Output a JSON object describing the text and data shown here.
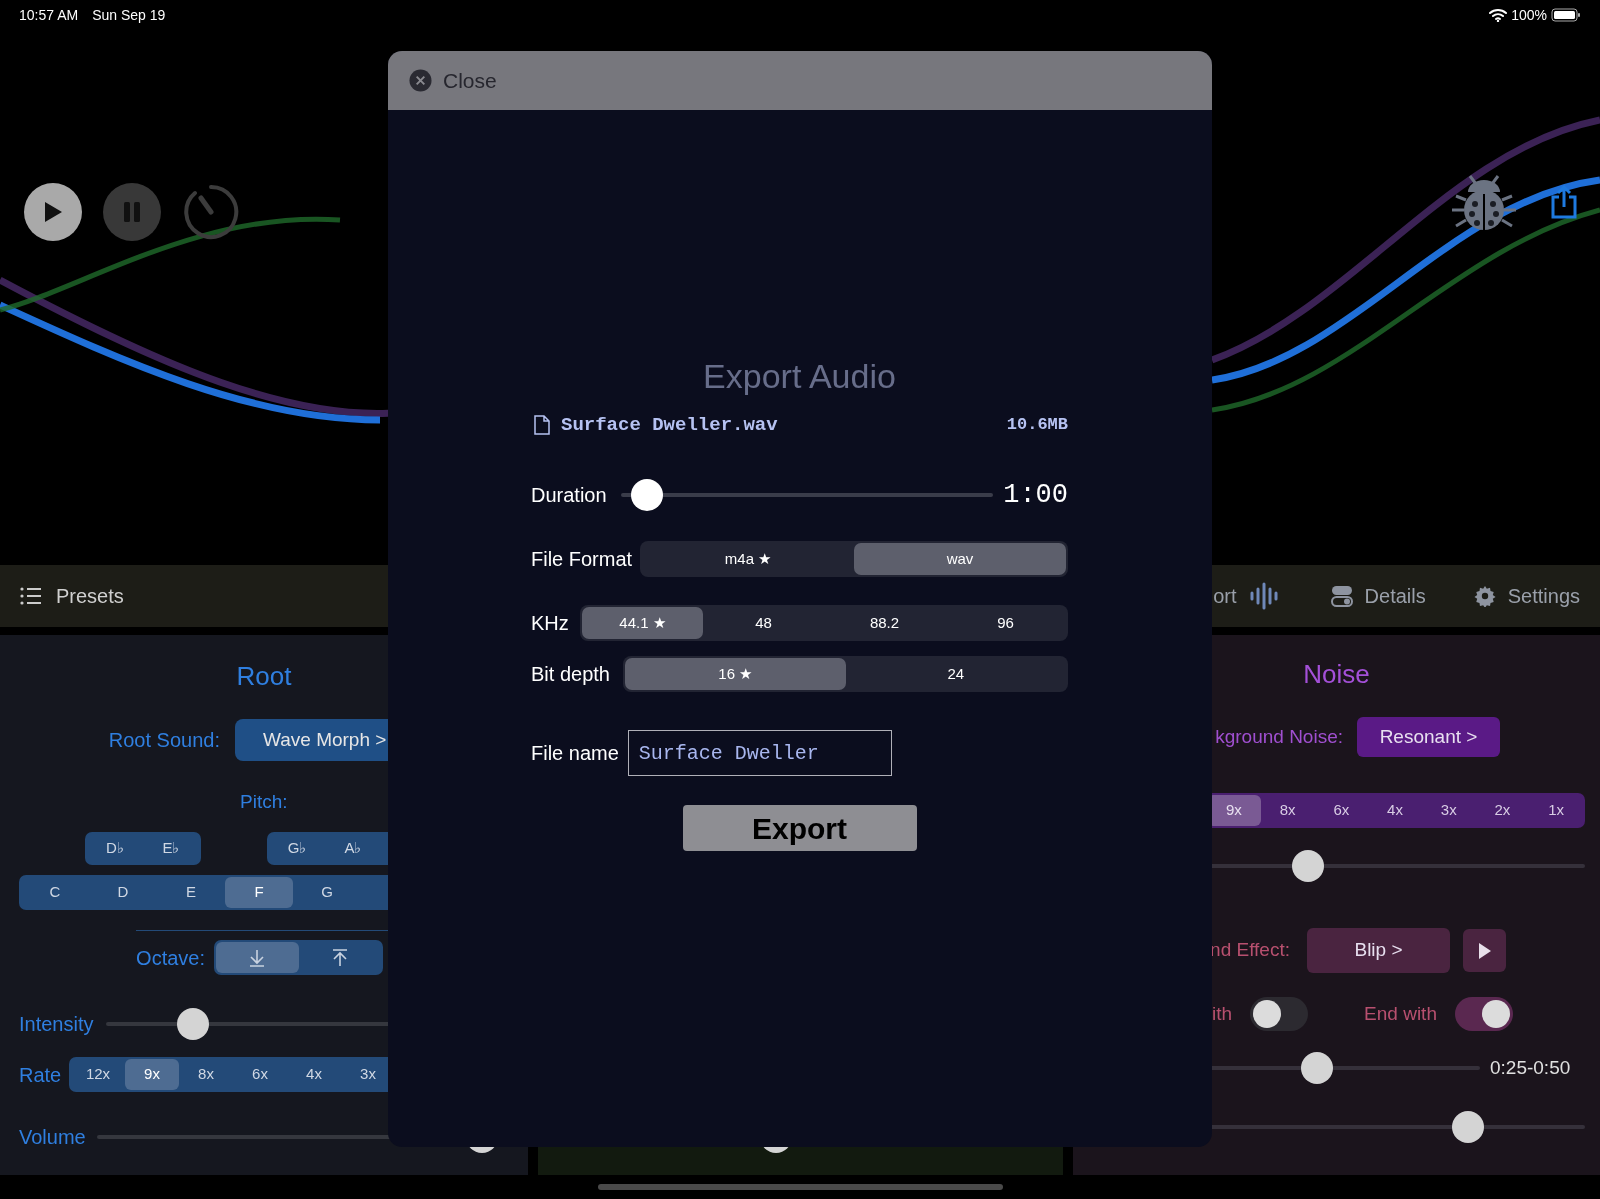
{
  "status_bar": {
    "time": "10:57 AM",
    "date": "Sun Sep 19",
    "battery": "100%"
  },
  "transport": [
    {
      "kind": "play"
    },
    {
      "kind": "pause"
    },
    {
      "kind": "timer"
    }
  ],
  "top_right_buttons": [
    {
      "kind": "bug"
    },
    {
      "kind": "share"
    }
  ],
  "toolbar": {
    "presets": "Presets",
    "items": [
      {
        "kind": "export",
        "label": "ort"
      },
      {
        "kind": "details",
        "label": "Details"
      },
      {
        "kind": "settings",
        "label": "Settings"
      }
    ]
  },
  "root_panel": {
    "title": "Root",
    "sound_label": "Root Sound:",
    "sound_button": "Wave Morph >",
    "pitch_label": "Pitch:",
    "flat_groups": [
      [
        {
          "label": "D♭",
          "selected": false
        },
        {
          "label": "E♭",
          "selected": false
        }
      ],
      [
        {
          "label": "G♭",
          "selected": false
        },
        {
          "label": "A♭",
          "selected": false
        }
      ]
    ],
    "notes": [
      {
        "label": "C",
        "selected": false
      },
      {
        "label": "D",
        "selected": false
      },
      {
        "label": "E",
        "selected": false
      },
      {
        "label": "F",
        "selected": true
      },
      {
        "label": "G",
        "selected": false
      }
    ],
    "octave_label": "Octave:",
    "octave": [
      {
        "kind": "down",
        "selected": true
      },
      {
        "kind": "up",
        "selected": false
      }
    ],
    "intensity": {
      "label": "Intensity",
      "level": 0.21
    },
    "rate": {
      "label": "Rate",
      "options": [
        {
          "label": "12x",
          "selected": false
        },
        {
          "label": "9x",
          "selected": true
        },
        {
          "label": "8x",
          "selected": false
        },
        {
          "label": "6x",
          "selected": false
        },
        {
          "label": "4x",
          "selected": false
        },
        {
          "label": "3x",
          "selected": false
        }
      ]
    },
    "volume": {
      "label": "Volume",
      "level": 0.92
    }
  },
  "center_panel": {
    "slider": {
      "level": 0.45
    }
  },
  "noise_panel": {
    "title": "Noise",
    "noise_label": "kground Noise:",
    "noise_button": "Resonant >",
    "rate": [
      {
        "label": "9x",
        "selected": true
      },
      {
        "label": "8x",
        "selected": false
      },
      {
        "label": "6x",
        "selected": false
      },
      {
        "label": "4x",
        "selected": false
      },
      {
        "label": "3x",
        "selected": false
      },
      {
        "label": "2x",
        "selected": false
      },
      {
        "label": "1x",
        "selected": false
      }
    ],
    "rate_slider": {
      "level": 0.31
    },
    "effect_label": "nd Effect:",
    "effect_button": "Blip >",
    "start_toggle": {
      "label": "ith",
      "on": false
    },
    "end_toggle": {
      "label": "End with",
      "on": true
    },
    "range_slider": {
      "level": 0.45,
      "reading": "0:25-0:50"
    },
    "volume_slider": {
      "level": 0.71
    }
  },
  "export_dialog": {
    "close": "Close",
    "title": "Export Audio",
    "file_name": "Surface Dweller.wav",
    "file_size": "10.6MB",
    "duration": {
      "label": "Duration",
      "level": 0.07,
      "reading": "1:00"
    },
    "file_format": {
      "label": "File Format",
      "options": [
        {
          "label": "m4a ★",
          "selected": false
        },
        {
          "label": "wav",
          "selected": true
        }
      ]
    },
    "khz": {
      "label": "KHz",
      "options": [
        {
          "label": "44.1 ★",
          "selected": true
        },
        {
          "label": "48",
          "selected": false
        },
        {
          "label": "88.2",
          "selected": false
        },
        {
          "label": "96",
          "selected": false
        }
      ]
    },
    "bit_depth": {
      "label": "Bit depth",
      "options": [
        {
          "label": "16 ★",
          "selected": true
        },
        {
          "label": "24",
          "selected": false
        }
      ]
    },
    "file_name_field": {
      "label": "File name",
      "value": "Surface Dweller"
    },
    "export_button": "Export"
  }
}
